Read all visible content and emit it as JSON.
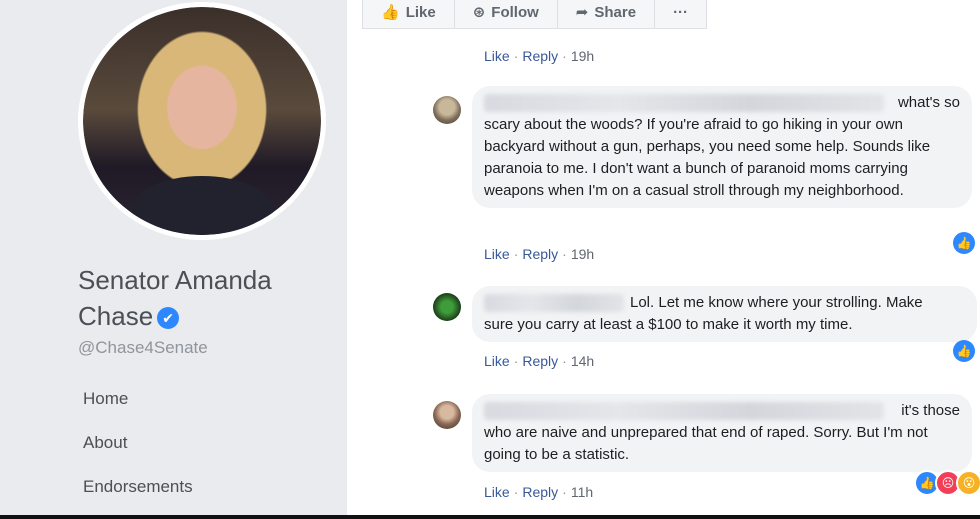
{
  "profile": {
    "name": "Senator Amanda Chase",
    "verified_glyph": "✔",
    "handle": "@Chase4Senate",
    "nav": [
      "Home",
      "About",
      "Endorsements"
    ]
  },
  "post_actions": [
    {
      "icon": "thumbs-up-icon",
      "glyph": "👍",
      "label": "Like"
    },
    {
      "icon": "follow-icon",
      "glyph": "⊛",
      "label": "Follow"
    },
    {
      "icon": "share-icon",
      "glyph": "➦",
      "label": "Share"
    },
    {
      "icon": "more-icon",
      "glyph": "",
      "label": "···"
    }
  ],
  "comment_action_labels": {
    "like": "Like",
    "reply": "Reply"
  },
  "comments": [
    {
      "time": "19h"
    },
    {
      "text": "what's so scary about the woods? If you're afraid to go hiking in your own backyard without a gun, perhaps, you need some help. Sounds like paranoia to me. I don't want a bunch of paranoid moms carrying weapons when I'm on a casual stroll through my neighborhood.",
      "line1": "what's so",
      "rest": "scary about the woods? If you're afraid to go hiking in your own backyard without a gun, perhaps, you need some help. Sounds like paranoia to me. I don't want a bunch of paranoid moms carrying weapons when I'm on a casual stroll through my neighborhood.",
      "time": "19h"
    },
    {
      "line1": "Lol. Let me know where your strolling. Make",
      "rest": "sure you carry at least a $100 to make it worth my time.",
      "time": "14h"
    },
    {
      "line1": "it's those",
      "rest": "who are naive and unprepared that end of raped. Sorry. But I'm not going to be a statistic.",
      "time": "11h"
    }
  ],
  "colors": {
    "link": "#385898",
    "bubble": "#f2f3f5",
    "accent": "#2d88ff"
  }
}
